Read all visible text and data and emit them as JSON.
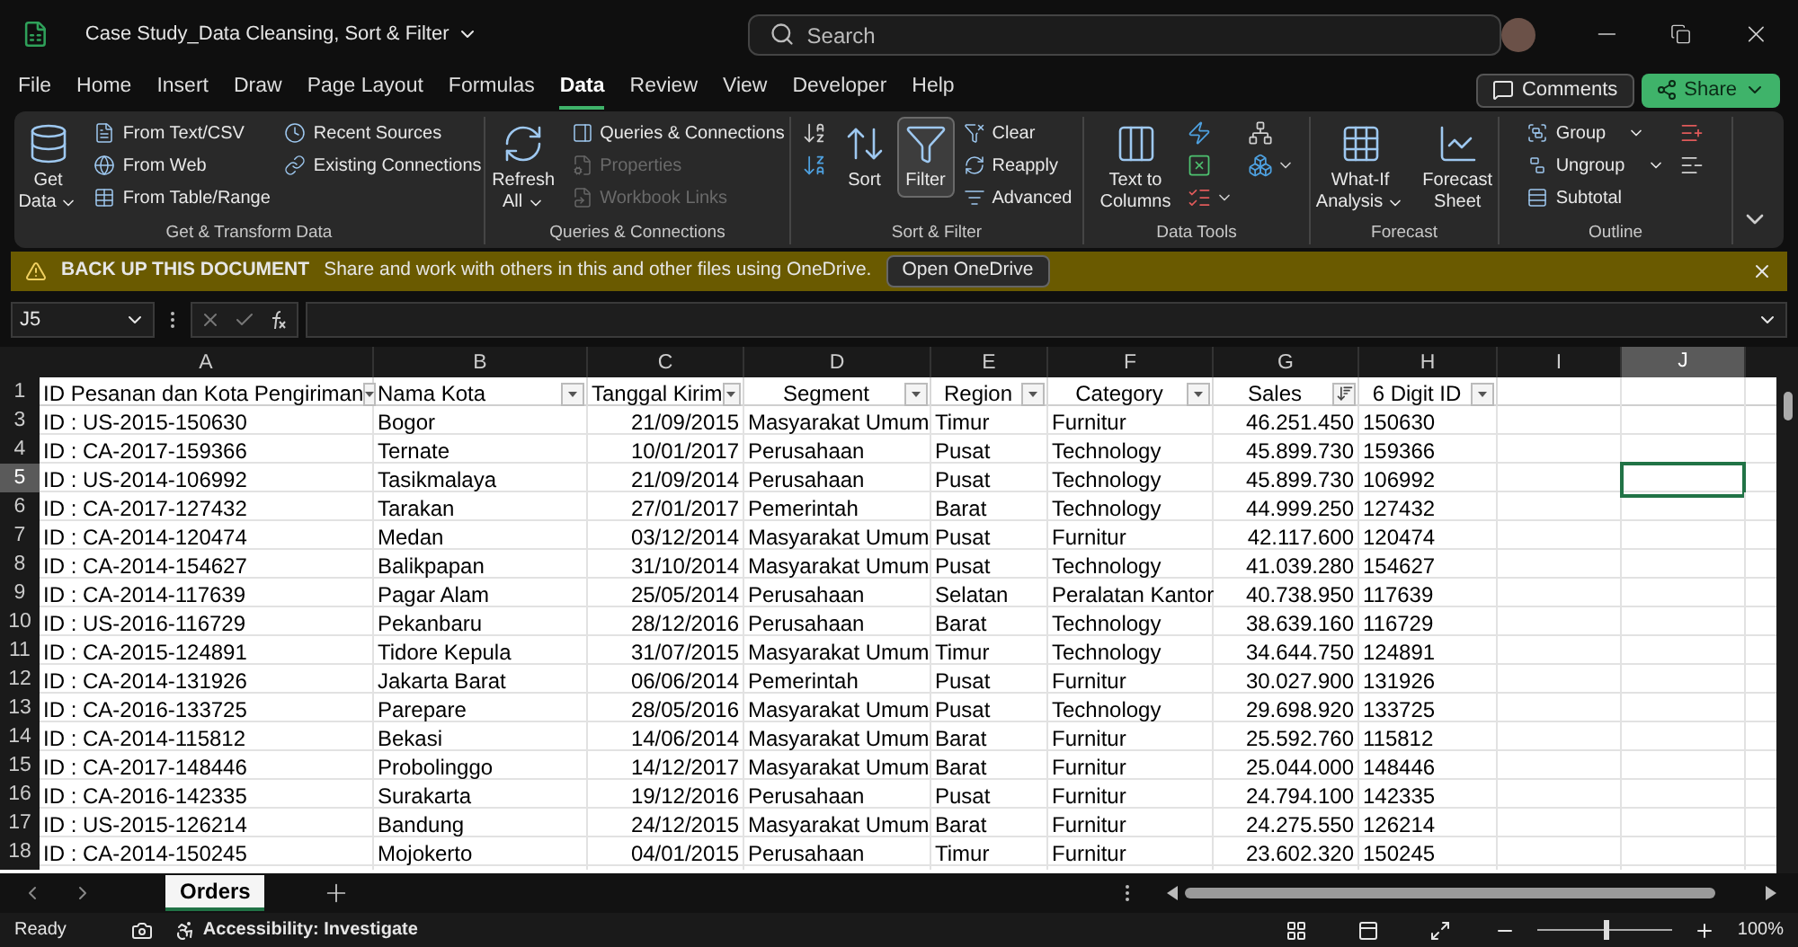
{
  "window": {
    "title": "Case Study_Data Cleansing, Sort & Filter"
  },
  "search": {
    "placeholder": "Search"
  },
  "menu": [
    {
      "label": "File",
      "selected": false
    },
    {
      "label": "Home",
      "selected": false
    },
    {
      "label": "Insert",
      "selected": false
    },
    {
      "label": "Draw",
      "selected": false
    },
    {
      "label": "Page Layout",
      "selected": false
    },
    {
      "label": "Formulas",
      "selected": false
    },
    {
      "label": "Data",
      "selected": true
    },
    {
      "label": "Review",
      "selected": false
    },
    {
      "label": "View",
      "selected": false
    },
    {
      "label": "Developer",
      "selected": false
    },
    {
      "label": "Help",
      "selected": false
    }
  ],
  "header_buttons": {
    "comments": "Comments",
    "share": "Share"
  },
  "ribbon_groups": [
    {
      "label": "Get & Transform Data",
      "items": [
        {
          "kind": "large",
          "lines": [
            "Get",
            "Data"
          ],
          "dropdown": true,
          "disabled": false
        },
        {
          "kind": "small",
          "label": "From Text/CSV",
          "disabled": false
        },
        {
          "kind": "small",
          "label": "From Web",
          "disabled": false
        },
        {
          "kind": "small",
          "label": "From Table/Range",
          "disabled": false
        },
        {
          "kind": "small",
          "label": "Recent Sources",
          "disabled": false
        },
        {
          "kind": "small",
          "label": "Existing Connections",
          "disabled": false
        }
      ]
    },
    {
      "label": "Queries & Connections",
      "items": [
        {
          "kind": "large",
          "lines": [
            "Refresh",
            "All"
          ],
          "dropdown": true,
          "disabled": false
        },
        {
          "kind": "small",
          "label": "Queries & Connections",
          "disabled": false
        },
        {
          "kind": "small",
          "label": "Properties",
          "disabled": true
        },
        {
          "kind": "small",
          "label": "Workbook Links",
          "disabled": true
        }
      ]
    },
    {
      "label": "Sort & Filter",
      "items": [
        {
          "kind": "icon",
          "disabled": false,
          "pressed": false
        },
        {
          "kind": "icon",
          "disabled": false,
          "pressed": false
        },
        {
          "kind": "large",
          "lines": [
            "Sort"
          ],
          "disabled": false,
          "pressed": false
        },
        {
          "kind": "large",
          "lines": [
            "Filter"
          ],
          "disabled": false,
          "pressed": true
        },
        {
          "kind": "small",
          "label": "Clear",
          "disabled": false,
          "pressed": false
        },
        {
          "kind": "small",
          "label": "Reapply",
          "disabled": false,
          "pressed": false
        },
        {
          "kind": "small",
          "label": "Advanced",
          "disabled": false,
          "pressed": false
        }
      ]
    },
    {
      "label": "Data Tools",
      "items": [
        {
          "kind": "large",
          "lines": [
            "Text to",
            "Columns"
          ],
          "disabled": false
        },
        {
          "kind": "icon",
          "disabled": false
        },
        {
          "kind": "icon",
          "disabled": false
        },
        {
          "kind": "icon",
          "dropdown": true,
          "disabled": false
        },
        {
          "kind": "icon",
          "disabled": false
        },
        {
          "kind": "icon",
          "dropdown": true,
          "disabled": false
        }
      ]
    },
    {
      "label": "Forecast",
      "items": [
        {
          "kind": "large",
          "lines": [
            "What-If",
            "Analysis"
          ],
          "dropdown": true,
          "disabled": false
        },
        {
          "kind": "large",
          "lines": [
            "Forecast",
            "Sheet"
          ],
          "disabled": false
        }
      ]
    },
    {
      "label": "Outline",
      "items": [
        {
          "kind": "small",
          "label": "Group",
          "dropdown": true,
          "disabled": false
        },
        {
          "kind": "small",
          "label": "Ungroup",
          "dropdown": true,
          "disabled": false
        },
        {
          "kind": "small",
          "label": "Subtotal",
          "disabled": false
        },
        {
          "kind": "icon",
          "disabled": false
        },
        {
          "kind": "icon",
          "disabled": false
        }
      ]
    }
  ],
  "banner": {
    "title": "BACK UP THIS DOCUMENT",
    "message": "Share and work with others in this and other files using OneDrive.",
    "button": "Open OneDrive"
  },
  "formula_bar": {
    "name_box": "J5"
  },
  "columns": [
    {
      "letter": "A",
      "selected": false
    },
    {
      "letter": "B",
      "selected": false
    },
    {
      "letter": "C",
      "selected": false
    },
    {
      "letter": "D",
      "selected": false
    },
    {
      "letter": "E",
      "selected": false
    },
    {
      "letter": "F",
      "selected": false
    },
    {
      "letter": "G",
      "selected": false
    },
    {
      "letter": "H",
      "selected": false
    },
    {
      "letter": "I",
      "selected": false
    },
    {
      "letter": "J",
      "selected": true
    }
  ],
  "table_header": {
    "row": "1",
    "cells": [
      {
        "text": "ID Pesanan dan Kota Pengiriman",
        "sorted": false
      },
      {
        "text": "Nama Kota",
        "sorted": false
      },
      {
        "text": "Tanggal Kirim",
        "sorted": false
      },
      {
        "text": "Segment",
        "sorted": false
      },
      {
        "text": "Region",
        "sorted": false
      },
      {
        "text": "Category",
        "sorted": false
      },
      {
        "text": "Sales",
        "sorted": true
      },
      {
        "text": "6 Digit ID",
        "sorted": false
      }
    ]
  },
  "rows": [
    {
      "row": "3",
      "selected": false,
      "cells": [
        "ID : US-2015-150630",
        "Bogor",
        "21/09/2015",
        "Masyarakat Umum",
        "Timur",
        "Furnitur",
        "46.251.450",
        "150630"
      ]
    },
    {
      "row": "4",
      "selected": false,
      "cells": [
        "ID : CA-2017-159366",
        "Ternate",
        "10/01/2017",
        "Perusahaan",
        "Pusat",
        "Technology",
        "45.899.730",
        "159366"
      ]
    },
    {
      "row": "5",
      "selected": true,
      "cells": [
        "ID : US-2014-106992",
        "Tasikmalaya",
        "21/09/2014",
        "Perusahaan",
        "Pusat",
        "Technology",
        "45.899.730",
        "106992"
      ]
    },
    {
      "row": "6",
      "selected": false,
      "cells": [
        "ID : CA-2017-127432",
        "Tarakan",
        "27/01/2017",
        "Pemerintah",
        "Barat",
        "Technology",
        "44.999.250",
        "127432"
      ]
    },
    {
      "row": "7",
      "selected": false,
      "cells": [
        "ID : CA-2014-120474",
        "Medan",
        "03/12/2014",
        "Masyarakat Umum",
        "Pusat",
        "Furnitur",
        "42.117.600",
        "120474"
      ]
    },
    {
      "row": "8",
      "selected": false,
      "cells": [
        "ID : CA-2014-154627",
        "Balikpapan",
        "31/10/2014",
        "Masyarakat Umum",
        "Pusat",
        "Technology",
        "41.039.280",
        "154627"
      ]
    },
    {
      "row": "9",
      "selected": false,
      "cells": [
        "ID : CA-2014-117639",
        "Pagar Alam",
        "25/05/2014",
        "Perusahaan",
        "Selatan",
        "Peralatan Kantor",
        "40.738.950",
        "117639"
      ]
    },
    {
      "row": "10",
      "selected": false,
      "cells": [
        "ID : US-2016-116729",
        "Pekanbaru",
        "28/12/2016",
        "Perusahaan",
        "Barat",
        "Technology",
        "38.639.160",
        "116729"
      ]
    },
    {
      "row": "11",
      "selected": false,
      "cells": [
        "ID : CA-2015-124891",
        "Tidore Kepula",
        "31/07/2015",
        "Masyarakat Umum",
        "Timur",
        "Technology",
        "34.644.750",
        "124891"
      ]
    },
    {
      "row": "12",
      "selected": false,
      "cells": [
        "ID : CA-2014-131926",
        "Jakarta Barat",
        "06/06/2014",
        "Pemerintah",
        "Pusat",
        "Furnitur",
        "30.027.900",
        "131926"
      ]
    },
    {
      "row": "13",
      "selected": false,
      "cells": [
        "ID : CA-2016-133725",
        "Parepare",
        "28/05/2016",
        "Masyarakat Umum",
        "Pusat",
        "Technology",
        "29.698.920",
        "133725"
      ]
    },
    {
      "row": "14",
      "selected": false,
      "cells": [
        "ID : CA-2014-115812",
        "Bekasi",
        "14/06/2014",
        "Masyarakat Umum",
        "Barat",
        "Furnitur",
        "25.592.760",
        "115812"
      ]
    },
    {
      "row": "15",
      "selected": false,
      "cells": [
        "ID : CA-2017-148446",
        "Probolinggo",
        "14/12/2017",
        "Masyarakat Umum",
        "Barat",
        "Furnitur",
        "25.044.000",
        "148446"
      ]
    },
    {
      "row": "16",
      "selected": false,
      "cells": [
        "ID : CA-2016-142335",
        "Surakarta",
        "19/12/2016",
        "Perusahaan",
        "Pusat",
        "Furnitur",
        "24.794.100",
        "142335"
      ]
    },
    {
      "row": "17",
      "selected": false,
      "cells": [
        "ID : US-2015-126214",
        "Bandung",
        "24/12/2015",
        "Masyarakat Umum",
        "Barat",
        "Furnitur",
        "24.275.550",
        "126214"
      ]
    },
    {
      "row": "18",
      "selected": false,
      "cells": [
        "ID : CA-2014-150245",
        "Mojokerto",
        "04/01/2015",
        "Perusahaan",
        "Timur",
        "Furnitur",
        "23.602.320",
        "150245"
      ]
    }
  ],
  "sheet_tabs": [
    {
      "label": "Orders",
      "selected": true
    }
  ],
  "status_bar": {
    "status": "Ready",
    "accessibility": "Accessibility: Investigate",
    "zoom": {
      "level": 0.5,
      "reading": "100%"
    }
  }
}
